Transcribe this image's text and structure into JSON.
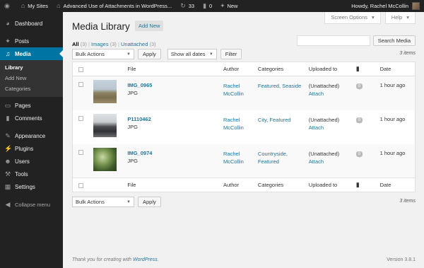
{
  "adminbar": {
    "my_sites": "My Sites",
    "site_name": "Advanced Use of Attachments in WordPress...",
    "updates_count": "33",
    "comments_count": "0",
    "new_label": "New",
    "howdy": "Howdy, Rachel McCollin"
  },
  "sidebar": {
    "items": [
      {
        "label": "Dashboard",
        "icon": "dashboard-icon"
      },
      {
        "label": "Posts",
        "icon": "pin-icon"
      },
      {
        "label": "Media",
        "icon": "media-icon"
      },
      {
        "label": "Pages",
        "icon": "page-icon"
      },
      {
        "label": "Comments",
        "icon": "comment-icon"
      },
      {
        "label": "Appearance",
        "icon": "brush-icon"
      },
      {
        "label": "Plugins",
        "icon": "plug-icon"
      },
      {
        "label": "Users",
        "icon": "user-icon"
      },
      {
        "label": "Tools",
        "icon": "wrench-icon"
      },
      {
        "label": "Settings",
        "icon": "settings-icon"
      }
    ],
    "media_submenu": [
      "Library",
      "Add New",
      "Categories"
    ],
    "collapse": "Collapse menu"
  },
  "screen_options": "Screen Options",
  "help": "Help",
  "page": {
    "title": "Media Library",
    "add_new": "Add New"
  },
  "filters": {
    "all": "All",
    "all_count": "(3)",
    "images": "Images",
    "images_count": "(3)",
    "unattached": "Unattached",
    "unattached_count": "(3)",
    "sep": "|"
  },
  "search": {
    "button": "Search Media"
  },
  "bulk": {
    "actions": "Bulk Actions",
    "apply": "Apply",
    "dates": "Show all dates",
    "filter": "Filter"
  },
  "items_count": "3 items",
  "table": {
    "columns": {
      "file": "File",
      "author": "Author",
      "categories": "Categories",
      "uploaded_to": "Uploaded to",
      "date": "Date"
    },
    "rows": [
      {
        "name": "IMG_0965",
        "type": "JPG",
        "author_line1": "Rachel",
        "author_line2": "McCollin",
        "categories_line1": "Featured, Seaside",
        "categories_line2": "",
        "uploaded_line1": "(Unattached)",
        "uploaded_line2": "Attach",
        "comments": "0",
        "date": "1 hour ago"
      },
      {
        "name": "P1110462",
        "type": "JPG",
        "author_line1": "Rachel",
        "author_line2": "McCollin",
        "categories_line1": "City, Featured",
        "categories_line2": "",
        "uploaded_line1": "(Unattached)",
        "uploaded_line2": "Attach",
        "comments": "0",
        "date": "1 hour ago"
      },
      {
        "name": "IMG_0974",
        "type": "JPG",
        "author_line1": "Rachel",
        "author_line2": "McCollin",
        "categories_line1": "Countryside,",
        "categories_line2": "Featured",
        "uploaded_line1": "(Unattached)",
        "uploaded_line2": "Attach",
        "comments": "0",
        "date": "1 hour ago"
      }
    ]
  },
  "footer": {
    "thanks_prefix": "Thank you for creating with ",
    "wordpress": "WordPress",
    "thanks_suffix": ".",
    "version": "Version 3.8.1"
  }
}
